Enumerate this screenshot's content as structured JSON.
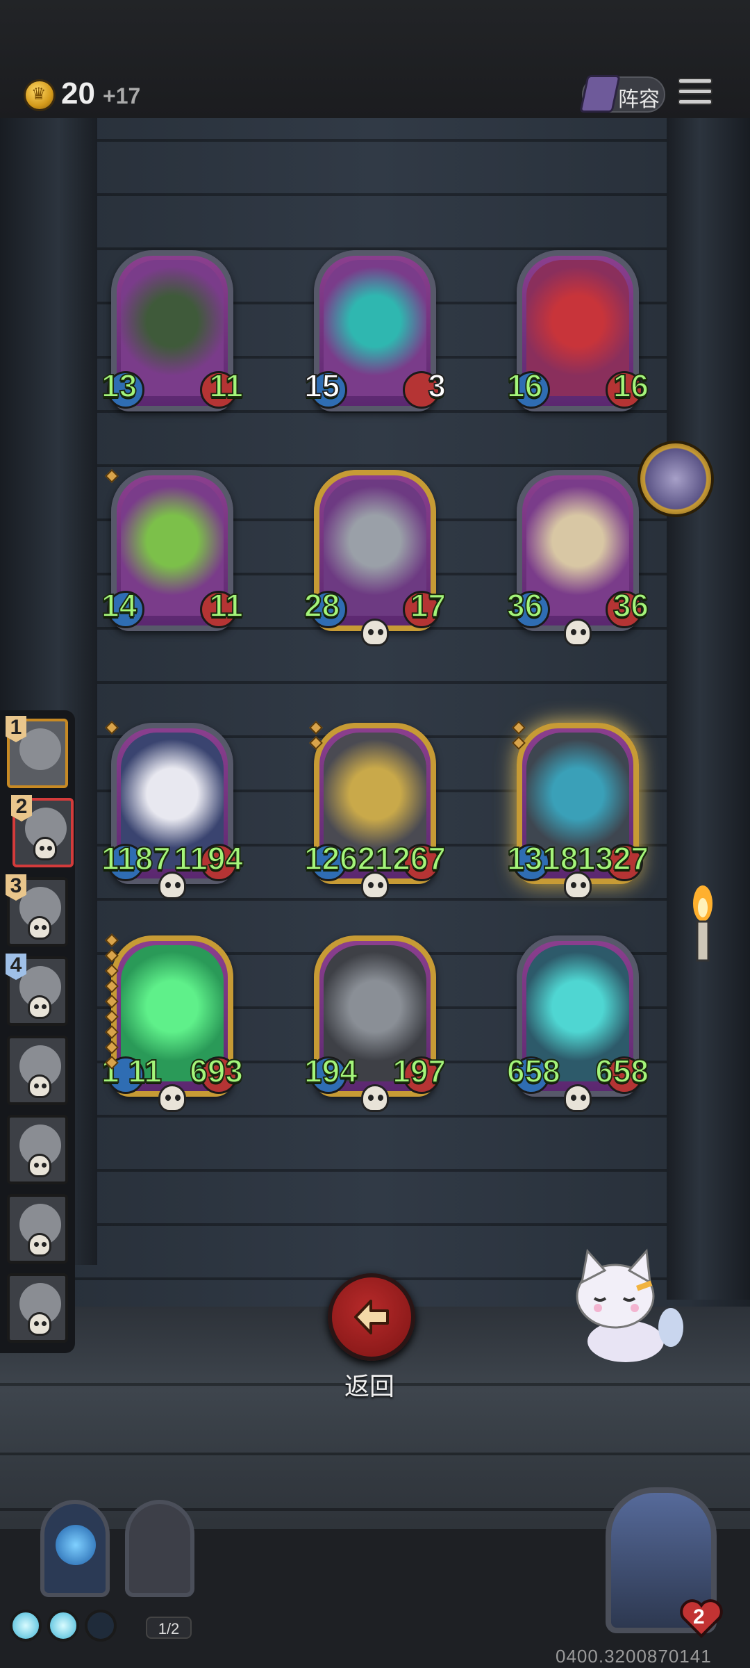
{
  "header": {
    "gold": "20",
    "gold_income": "+17",
    "lineup_label": "阵容",
    "icons": [
      "crown-coin-icon",
      "book-icon",
      "hamburger-menu-icon"
    ]
  },
  "board": {
    "cards": [
      {
        "name": "masked-shaman",
        "attack": "13",
        "health": "11",
        "frame": "silver",
        "bg": "#7a3c8a",
        "accent": "#3f5a3a"
      },
      {
        "name": "serpent-priestess",
        "attack": "15",
        "health": "3",
        "frame": "silver",
        "bg": "#7a3c8a",
        "accent": "#2fb7b0",
        "attack_white": true,
        "health_white": true
      },
      {
        "name": "jester-puppet",
        "attack": "16",
        "health": "16",
        "frame": "silver",
        "bg": "#8a2f5c",
        "accent": "#c8343a"
      },
      {
        "name": "horned-dragon",
        "attack": "14",
        "health": "11",
        "frame": "silver",
        "bg": "#7a3c8a",
        "accent": "#7cc04a"
      },
      {
        "name": "horn-beast",
        "attack": "28",
        "health": "17",
        "frame": "gold",
        "bg": "#6d3a82",
        "accent": "#9aa0a8"
      },
      {
        "name": "bone-dragon",
        "attack": "36",
        "health": "36",
        "frame": "silver",
        "bg": "#7a3c8a",
        "accent": "#d8c7a4"
      },
      {
        "name": "star-wizard",
        "attack": "1187",
        "health": "1194",
        "frame": "silver",
        "bg": "#3a4470",
        "accent": "#e8e8f0"
      },
      {
        "name": "brass-automaton",
        "attack": "1262",
        "health": "1267",
        "frame": "gold",
        "bg": "#4a4a52",
        "accent": "#c9a94a"
      },
      {
        "name": "armored-knight",
        "attack": "1318",
        "health": "1327",
        "frame": "gold",
        "bg": "#3e4650",
        "accent": "#3aa0b8",
        "glow": true
      },
      {
        "name": "green-phantom",
        "attack": "1 11",
        "health": "693",
        "frame": "gold",
        "bg": "#2a9a58",
        "accent": "#5ff08a"
      },
      {
        "name": "bell-robot",
        "attack": "194",
        "health": "197",
        "frame": "gold",
        "bg": "#3e4046",
        "accent": "#8a8f96"
      },
      {
        "name": "spectral-giant",
        "attack": "658",
        "health": "658",
        "frame": "silver",
        "bg": "#2d5a6a",
        "accent": "#4fd6d2"
      }
    ]
  },
  "roster": {
    "slots": [
      {
        "rank": "1",
        "state": "active"
      },
      {
        "rank": "2",
        "state": "selected"
      },
      {
        "rank": "3",
        "state": "normal"
      },
      {
        "rank": "4",
        "state": "normal",
        "rank_color": "blue"
      },
      {
        "rank": "",
        "state": "normal"
      },
      {
        "rank": "",
        "state": "normal"
      },
      {
        "rank": "",
        "state": "normal"
      },
      {
        "rank": "",
        "state": "normal"
      }
    ]
  },
  "actions": {
    "return_label": "返回",
    "return_icon": "left-arrow-icon"
  },
  "footer": {
    "page_count": "1/2",
    "hero_lives": "2",
    "build_id": "0400.3200870141"
  },
  "colors": {
    "stat_green": "#a4f57a",
    "return_red": "#b72a2a",
    "gold_frame": "#c79b35",
    "silver_frame": "#57596a"
  }
}
